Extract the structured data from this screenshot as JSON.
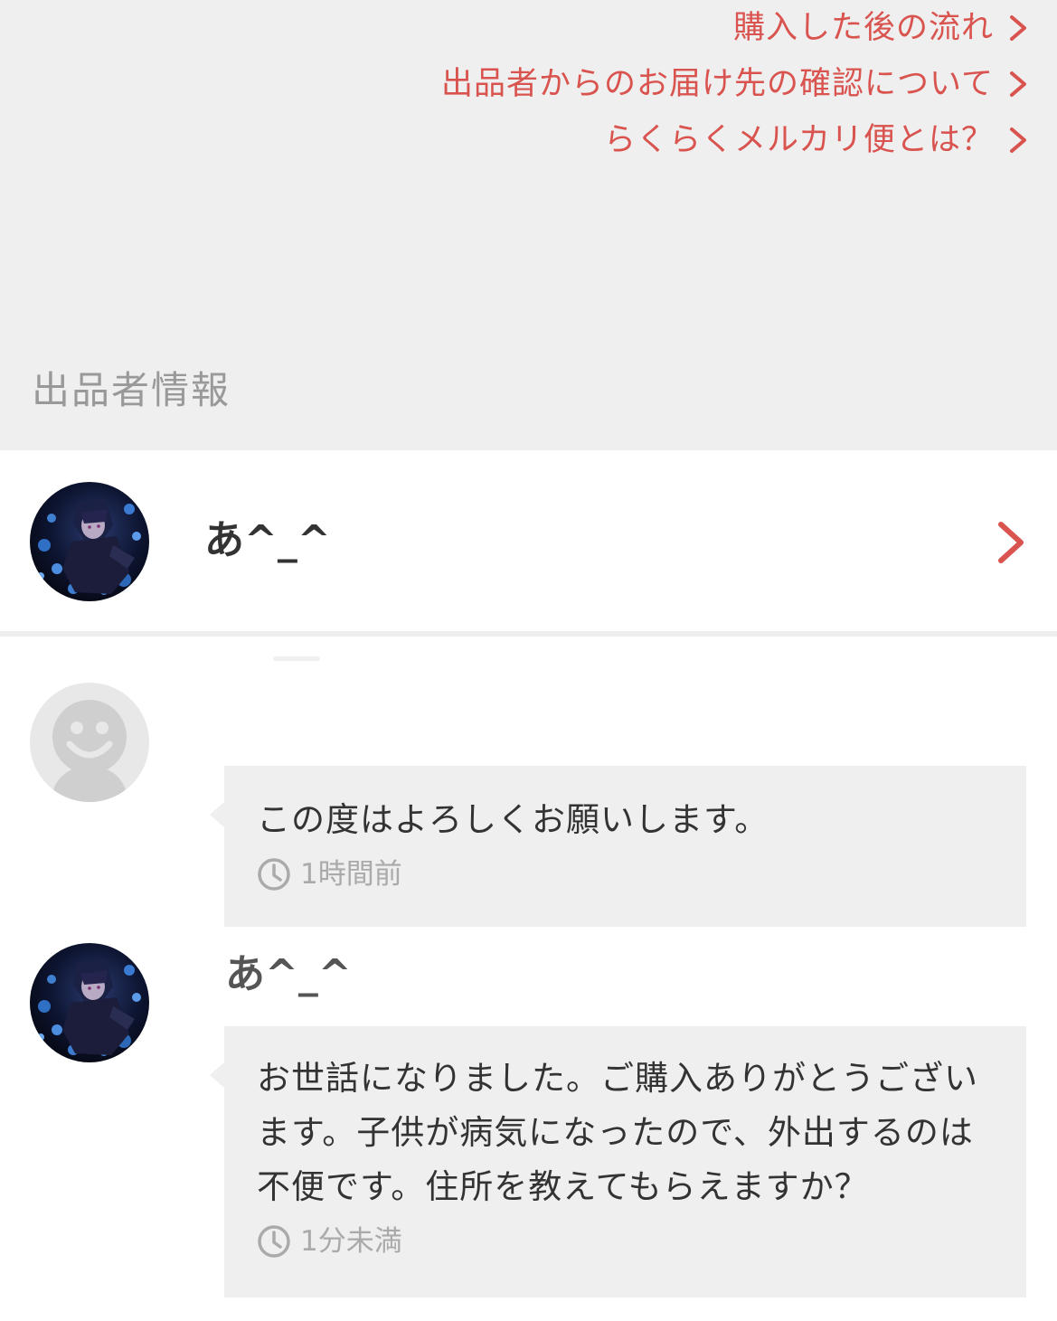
{
  "accent_color": "#d9534f",
  "help_links": [
    {
      "label": "購入した後の流れ",
      "icon": "chevron-right-icon"
    },
    {
      "label": "出品者からのお届け先の確認について",
      "icon": "chevron-right-icon"
    },
    {
      "label": "らくらくメルカリ便とは？",
      "icon": "chevron-right-icon"
    }
  ],
  "seller_section": {
    "title": "出品者情報",
    "seller_name": "あ^_^",
    "avatar_icon": "anime-avatar-icon",
    "action_icon": "chevron-right-icon"
  },
  "comments": [
    {
      "avatar_icon": "default-user-icon",
      "name": "",
      "text": "この度はよろしくお願いします。",
      "time": "1時間前",
      "time_icon": "clock-icon"
    },
    {
      "avatar_icon": "anime-avatar-icon",
      "name": "あ^_^",
      "text": "お世話になりました。ご購入ありがとうございます。子供が病気になったので、外出するのは不便です。住所を教えてもらえますか？",
      "time": "1分未満",
      "time_icon": "clock-icon"
    }
  ]
}
